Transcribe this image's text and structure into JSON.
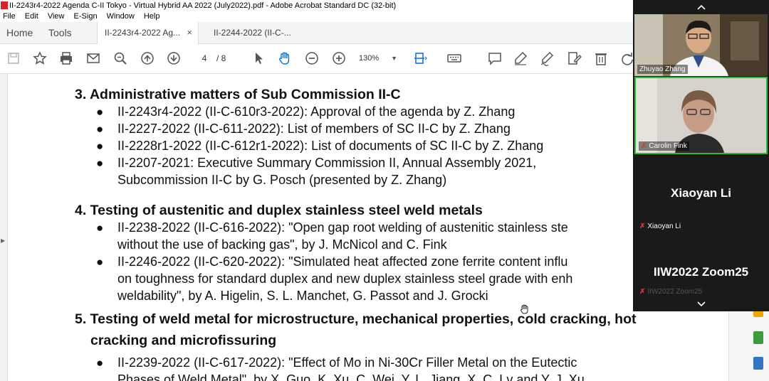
{
  "window": {
    "title": "II-2243r4-2022 Agenda C-II Tokyo - Virtual Hybrid AA 2022 (July2022).pdf - Adobe Acrobat Standard DC (32-bit)",
    "menu": [
      "File",
      "Edit",
      "View",
      "E-Sign",
      "Window",
      "Help"
    ]
  },
  "tabs": {
    "home": "Home",
    "tools": "Tools",
    "doc_tabs": [
      {
        "label": "II-2243r4-2022 Ag...",
        "close": "×"
      },
      {
        "label": "II-2244-2022 (II-C-..."
      }
    ]
  },
  "toolbar": {
    "page_current": "4",
    "page_total": "/ 8",
    "zoom": "130%",
    "icons": [
      "save-icon",
      "bookmark-star-icon",
      "print-icon",
      "email-icon",
      "search-zoom-icon",
      "page-up-icon",
      "page-down-icon",
      "select-cursor-icon",
      "hand-tool-icon",
      "zoom-out-icon",
      "zoom-in-icon",
      "fit-page-icon",
      "keyboard-icon",
      "comment-icon",
      "highlight-icon",
      "sign-icon",
      "edit-pdf-icon",
      "delete-icon",
      "rotate-icon"
    ]
  },
  "document": {
    "sections": [
      {
        "heading": "3. Administrative matters of Sub Commission II-C",
        "items": [
          [
            "II-2243r4-2022 (II-C-610r3-2022): Approval of the agenda by Z. Zhang"
          ],
          [
            "II-2227-2022 (II-C-611-2022): List of members of SC II-C by Z. Zhang"
          ],
          [
            "II-2228r1-2022 (II-C-612r1-2022): List of documents of SC II-C by Z. Zhang"
          ],
          [
            "II-2207-2021: Executive Summary Commission II, Annual Assembly 2021,",
            "Subcommission II-C by G. Posch (presented by Z. Zhang)"
          ]
        ]
      },
      {
        "heading": "4. Testing of austenitic and duplex stainless steel weld metals",
        "items": [
          [
            "II-2238-2022 (II-C-616-2022): \"Open gap root welding of austenitic stainless ste",
            "without the use of backing gas\", by J. McNicol and C. Fink"
          ],
          [
            "II-2246-2022 (II-C-620-2022): \"Simulated heat affected zone ferrite content influ",
            "on toughness for standard duplex and new duplex stainless steel grade with enh",
            "weldability\", by A. Higelin, S. L. Manchet, G. Passot and J. Grocki"
          ]
        ]
      },
      {
        "heading_lines": [
          "5. Testing of weld metal for microstructure, mechanical properties, cold cracking, hot",
          "cracking and microfissuring"
        ],
        "items": [
          [
            "II-2239-2022 (II-C-617-2022): \"Effect of Mo in Ni-30Cr Filler Metal on the Eutectic",
            "Phases of Weld Metal\", by X. Guo, K. Xu, C. Wei, Y. L. Jiang, X. C. Lv and Y. J. Xu"
          ]
        ]
      }
    ]
  },
  "zoom_panel": {
    "participants": [
      {
        "name": "Zhuyao Zhang"
      },
      {
        "name": "Carolin Fink"
      },
      {
        "name": "Xiaoyan Li",
        "label": "Xiaoyan Li"
      },
      {
        "name": "IIW2022 Zoom25",
        "label": "IIW2022 Zoom25"
      }
    ],
    "colors": {
      "background": "#1a1a1a",
      "muted_mic": "#e0342e",
      "active_border": "#2dbb3c"
    }
  },
  "colors": {
    "tab_bg": "#f4f4f4",
    "accent_blue": "#1473e6"
  }
}
